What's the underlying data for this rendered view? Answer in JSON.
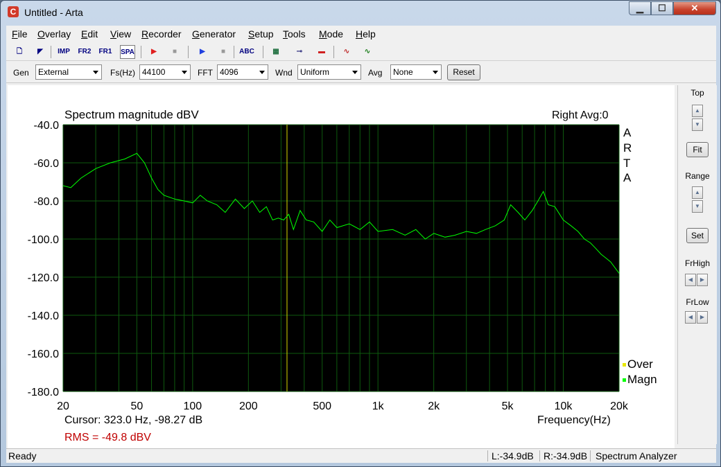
{
  "window": {
    "title": "Untitled - Arta",
    "app_icon": "C"
  },
  "caption_buttons": {
    "minimize": "▁",
    "maximize": "☐",
    "close": "✕"
  },
  "menu": [
    "File",
    "Overlay",
    "Edit",
    "View",
    "Recorder",
    "Generator",
    "Setup",
    "Tools",
    "Mode",
    "Help"
  ],
  "toolbar": {
    "buttons": [
      {
        "name": "new-icon",
        "label": "🗋"
      },
      {
        "name": "open-icon",
        "label": "◤"
      },
      {
        "name": "imp-mode-button",
        "label": "IMP"
      },
      {
        "name": "fr2-mode-button",
        "label": "FR2"
      },
      {
        "name": "fr1-mode-button",
        "label": "FR1"
      },
      {
        "name": "spa-mode-button",
        "label": "SPA"
      },
      {
        "name": "record-icon",
        "label": "▶"
      },
      {
        "name": "stop-icon",
        "label": "■"
      },
      {
        "name": "play-icon",
        "label": "▶"
      },
      {
        "name": "stop2-icon",
        "label": "■"
      },
      {
        "name": "abc-icon",
        "label": "ABC"
      },
      {
        "name": "meter-icon",
        "label": "▦"
      },
      {
        "name": "probe-icon",
        "label": "⊸"
      },
      {
        "name": "levels-icon",
        "label": "▬"
      },
      {
        "name": "signal-icon",
        "label": "∿"
      },
      {
        "name": "scope-icon",
        "label": "∿"
      }
    ]
  },
  "options": {
    "gen": {
      "label": "Gen",
      "value": "External"
    },
    "fs": {
      "label": "Fs(Hz)",
      "value": "44100"
    },
    "fft": {
      "label": "FFT",
      "value": "4096"
    },
    "wnd": {
      "label": "Wnd",
      "value": "Uniform"
    },
    "avg": {
      "label": "Avg",
      "value": "None"
    },
    "reset": "Reset"
  },
  "plot": {
    "title": "Spectrum magnitude dBV",
    "channel_info": "Right  Avg:0",
    "arta_letters": [
      "A",
      "R",
      "T",
      "A"
    ],
    "legend": [
      {
        "label": "Over",
        "color": "#e8e800"
      },
      {
        "label": "Magn",
        "color": "#00ff00"
      }
    ],
    "cursor_text": "Cursor:   323.0 Hz, -98.27 dB",
    "rms_text": "RMS =  -49.8 dBV",
    "freq_label": "Frequency(Hz)"
  },
  "side": {
    "top": "Top",
    "fit": "Fit",
    "range": "Range",
    "set": "Set",
    "frhigh": "FrHigh",
    "frlow": "FrLow",
    "up": "▲",
    "down": "▼",
    "left": "◀",
    "right": "▶"
  },
  "status": {
    "ready": "Ready",
    "left_level": "L:-34.9dB",
    "right_level": "R:-34.9dB",
    "mode": "Spectrum Analyzer"
  },
  "chart_data": {
    "type": "line",
    "title": "Spectrum magnitude dBV",
    "xlabel": "Frequency(Hz)",
    "ylabel": "",
    "xscale": "log",
    "xlim": [
      20,
      20000
    ],
    "ylim": [
      -180,
      -40
    ],
    "x_ticks": [
      20,
      50,
      100,
      200,
      500,
      1000,
      2000,
      5000,
      10000,
      20000
    ],
    "x_tick_labels": [
      "20",
      "50",
      "100",
      "200",
      "500",
      "1k",
      "2k",
      "5k",
      "10k",
      "20k"
    ],
    "y_ticks": [
      -40,
      -60,
      -80,
      -100,
      -120,
      -140,
      -160,
      -180
    ],
    "y_tick_labels": [
      "-40.0",
      "-60.0",
      "-80.0",
      "-100.0",
      "-120.0",
      "-140.0",
      "-160.0",
      "-180.0"
    ],
    "grid": true,
    "background": "#000000",
    "cursor_hz": 323.0,
    "series": [
      {
        "name": "Magn",
        "color": "#00ff00",
        "x": [
          20,
          22,
          25,
          30,
          36,
          43,
          50,
          55,
          60,
          65,
          70,
          80,
          90,
          100,
          110,
          120,
          135,
          150,
          170,
          190,
          210,
          230,
          250,
          270,
          290,
          310,
          330,
          350,
          380,
          410,
          450,
          500,
          550,
          600,
          700,
          800,
          900,
          1000,
          1200,
          1400,
          1600,
          1800,
          2000,
          2300,
          2600,
          3000,
          3400,
          3800,
          4300,
          4800,
          5200,
          5700,
          6200,
          6800,
          7300,
          7800,
          8300,
          9000,
          10000,
          11000,
          12000,
          13000,
          14000,
          15000,
          16000,
          17000,
          18000,
          19000,
          20000
        ],
        "y": [
          -72,
          -73,
          -68,
          -63,
          -60,
          -58,
          -55,
          -60,
          -68,
          -74,
          -77,
          -79,
          -80,
          -81,
          -77,
          -80,
          -82,
          -86,
          -79,
          -84,
          -80,
          -86,
          -83,
          -90,
          -89,
          -90,
          -87,
          -95,
          -85,
          -90,
          -91,
          -96,
          -90,
          -94,
          -92,
          -95,
          -91,
          -96,
          -95,
          -98,
          -95,
          -100,
          -97,
          -99,
          -98,
          -96,
          -97,
          -95,
          -93,
          -90,
          -82,
          -86,
          -90,
          -85,
          -80,
          -75,
          -82,
          -83,
          -90,
          -93,
          -96,
          -100,
          -102,
          -105,
          -108,
          -110,
          -112,
          -115,
          -118
        ]
      }
    ]
  }
}
